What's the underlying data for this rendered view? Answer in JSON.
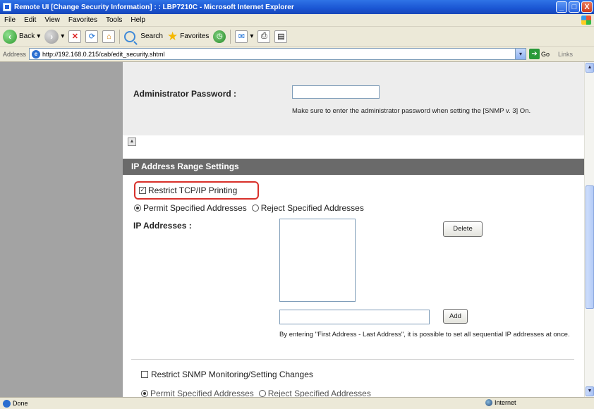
{
  "window": {
    "title": "Remote UI [Change Security Information] : : LBP7210C - Microsoft Internet Explorer",
    "min_label": "_",
    "max_label": "□",
    "close_label": "X"
  },
  "menu": [
    "File",
    "Edit",
    "View",
    "Favorites",
    "Tools",
    "Help"
  ],
  "toolbar": {
    "back_label": "Back",
    "back_dropdown": "▾",
    "forward_dropdown": "▾",
    "search_label": "Search",
    "favorites_label": "Favorites",
    "mail_dropdown": "▾"
  },
  "address": {
    "label": "Address",
    "url": "http://192.168.0.215/cab/edit_security.shtml",
    "go_label": "Go",
    "links_label": "Links"
  },
  "password": {
    "label": "Administrator Password :",
    "value": "",
    "note": "Make sure to enter the administrator password when setting the [SNMP v. 3] On."
  },
  "ip_section": {
    "header": "IP Address Range Settings",
    "restrict_tcpip_label": "Restrict TCP/IP Printing",
    "restrict_tcpip_checked": true,
    "permit_label": "Permit Specified Addresses",
    "reject_label": "Reject Specified Addresses",
    "selected_mode": "permit",
    "ip_addresses_label": "IP Addresses :",
    "ip_list": [],
    "delete_label": "Delete",
    "add_label": "Add",
    "add_value": "",
    "range_note": "By entering \"First Address - Last Address\", it is possible to set all sequential IP addresses at once."
  },
  "snmp": {
    "restrict_label": "Restrict SNMP Monitoring/Setting Changes",
    "restrict_checked": false,
    "permit_label": "Permit Specified Addresses",
    "reject_label": "Reject Specified Addresses"
  },
  "status": {
    "text": "Done",
    "zone": "Internet"
  },
  "colors": {
    "titlebar": "#1a55d3",
    "sidebar": "#a3a3a3",
    "section_header": "#6a6a6a",
    "highlight": "#d8302a"
  }
}
